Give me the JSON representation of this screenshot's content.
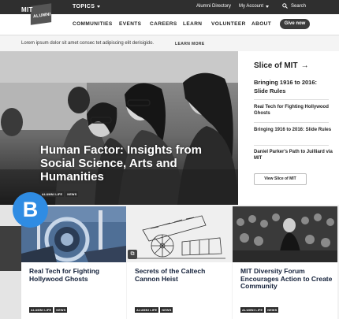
{
  "topbar": {
    "topics_label": "TOPICS",
    "alumni_directory": "Alumni Directory",
    "my_account": "My Account",
    "search_label": "Search"
  },
  "logo": {
    "mit": "MIT",
    "alumni": "ALUMNI"
  },
  "nav": {
    "items": [
      "COMMUNITIES",
      "EVENTS",
      "CAREERS",
      "LEARN",
      "VOLUNTEER",
      "ABOUT"
    ],
    "give_label": "Give now"
  },
  "notice": {
    "text": "Lorem ipsum dolor sit amet consec tet adipiscing elit derisigido.",
    "learn_more": "LEARN MORE"
  },
  "hero": {
    "title": "Human Factor: Insights from Social Science, Arts and Humanities",
    "tags": [
      "ALUMNI LIFE",
      "NEWS"
    ]
  },
  "sidebar": {
    "heading": "Slice of MIT",
    "items": [
      "Bringing 1916 to 2016: Slide Rules",
      "Real Tech for Fighting Hollywood Ghosts",
      "Bringing 1916 to 2016: Slide Rules",
      "Daniel Parker's Path to Juilliard via MIT"
    ],
    "view_button": "View Slice of MIT"
  },
  "badge": "B",
  "cards": [
    {
      "title": "Real Tech for Fighting Hollywood Ghosts",
      "tags": [
        "ALUMNI LIFE",
        "NEWS"
      ]
    },
    {
      "title": "Secrets of the Caltech Cannon Heist",
      "tags": [
        "ALUMNI LIFE",
        "NEWS"
      ]
    },
    {
      "title": "MIT Diversity Forum Encourages Action to Create Community",
      "tags": [
        "ALUMNI LIFE",
        "NEWS"
      ]
    }
  ],
  "colors": {
    "topbar": "#2f2f2f",
    "badge": "#2f8ce3",
    "title_navy": "#15223b"
  }
}
